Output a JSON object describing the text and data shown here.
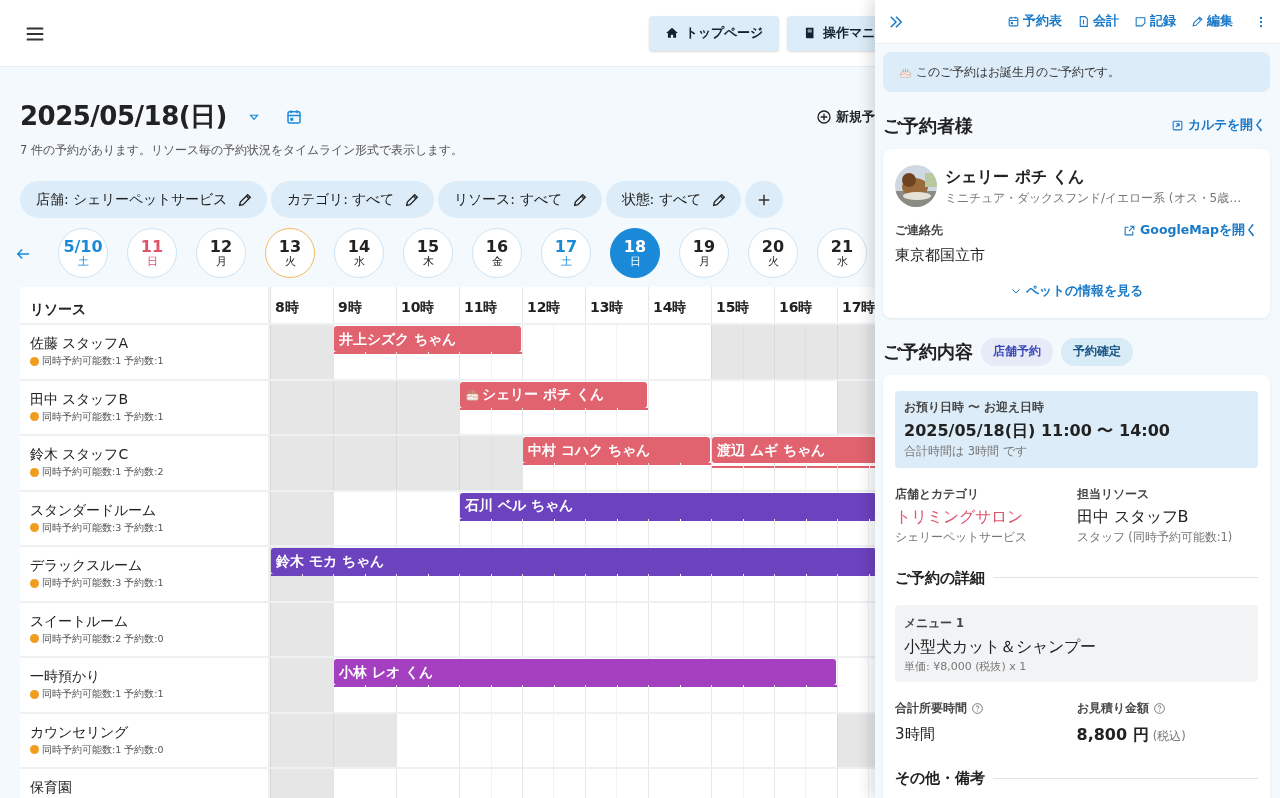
{
  "nav_buttons": [
    {
      "label": "トップページ",
      "kind": "home"
    },
    {
      "label": "操作マニ",
      "kind": "book"
    }
  ],
  "date_title": "2025/05/18(日)",
  "summary": "7 件の予約があります。リソース毎の予約状況をタイムライン形式で表示します。",
  "new_button": "新規予",
  "filters": [
    "店舗: シェリーペットサービス",
    "カテゴリ: すべて",
    "リソース: すべて",
    "状態: すべて"
  ],
  "dates": [
    {
      "day": "5/10",
      "weekday": "土",
      "kind": "saturday",
      "today": false,
      "selected": false
    },
    {
      "day": "11",
      "weekday": "日",
      "kind": "sunday",
      "today": false,
      "selected": false
    },
    {
      "day": "12",
      "weekday": "月",
      "kind": "weekday",
      "today": false,
      "selected": false
    },
    {
      "day": "13",
      "weekday": "火",
      "kind": "weekday",
      "today": true,
      "selected": false
    },
    {
      "day": "14",
      "weekday": "水",
      "kind": "weekday",
      "today": false,
      "selected": false
    },
    {
      "day": "15",
      "weekday": "木",
      "kind": "weekday",
      "today": false,
      "selected": false
    },
    {
      "day": "16",
      "weekday": "金",
      "kind": "weekday",
      "today": false,
      "selected": false
    },
    {
      "day": "17",
      "weekday": "土",
      "kind": "saturday",
      "today": false,
      "selected": false
    },
    {
      "day": "18",
      "weekday": "日",
      "kind": "sunday",
      "today": false,
      "selected": true
    },
    {
      "day": "19",
      "weekday": "月",
      "kind": "weekday",
      "today": false,
      "selected": false
    },
    {
      "day": "20",
      "weekday": "火",
      "kind": "weekday",
      "today": false,
      "selected": false
    },
    {
      "day": "21",
      "weekday": "水",
      "kind": "weekday",
      "today": false,
      "selected": false
    }
  ],
  "timeline": {
    "resource_header": "リソース",
    "hours": [
      "8時",
      "9時",
      "10時",
      "11時",
      "12時",
      "13時",
      "14時",
      "15時",
      "16時",
      "17時"
    ],
    "rows": [
      {
        "name": "佐藤 スタッフA",
        "info": "同時予約可能数:1 予約数:1",
        "closed": [
          true,
          true,
          false,
          false,
          false,
          false,
          false,
          false,
          false,
          false,
          false,
          false,
          false,
          false,
          true,
          true,
          true,
          true,
          true,
          true
        ],
        "bookings": [
          {
            "label": "井上シズク ちゃん",
            "slots": [
              false,
              false,
              true,
              true,
              true,
              true,
              true,
              true,
              false,
              false,
              false,
              false,
              false,
              false,
              false,
              false,
              false,
              false,
              false,
              false
            ],
            "color": "#e0636f",
            "birthday": false
          }
        ]
      },
      {
        "name": "田中 スタッフB",
        "info": "同時予約可能数:1 予約数:1",
        "closed": [
          true,
          true,
          true,
          true,
          true,
          true,
          false,
          false,
          false,
          false,
          false,
          false,
          false,
          false,
          false,
          false,
          false,
          false,
          true,
          true
        ],
        "bookings": [
          {
            "label": "シェリー ポチ くん",
            "slots": [
              false,
              false,
              false,
              false,
              false,
              false,
              true,
              true,
              true,
              true,
              true,
              true,
              false,
              false,
              false,
              false,
              false,
              false,
              false,
              false
            ],
            "color": "#e0636f",
            "birthday": true
          }
        ]
      },
      {
        "name": "鈴木 スタッフC",
        "info": "同時予約可能数:1 予約数:2",
        "closed": [
          true,
          true,
          true,
          true,
          true,
          true,
          true,
          true,
          false,
          false,
          false,
          false,
          false,
          false,
          false,
          false,
          false,
          false,
          false,
          false
        ],
        "bookings": [
          {
            "label": "中村 コハク ちゃん",
            "slots": [
              false,
              false,
              false,
              false,
              false,
              false,
              false,
              false,
              true,
              true,
              true,
              true,
              true,
              true,
              false,
              false,
              false,
              false,
              false,
              false
            ],
            "color": "#e0636f",
            "birthday": false
          },
          {
            "label": "渡辺 ムギ ちゃん",
            "slots": [
              false,
              false,
              false,
              false,
              false,
              false,
              false,
              false,
              false,
              false,
              false,
              false,
              false,
              false,
              true,
              true,
              true,
              true,
              true,
              true
            ],
            "color": "#e0636f",
            "birthday": false
          }
        ]
      },
      {
        "name": "スタンダードルーム",
        "info": "同時予約可能数:3 予約数:1",
        "closed": [
          true,
          true,
          false,
          false,
          false,
          false,
          false,
          false,
          false,
          false,
          false,
          false,
          false,
          false,
          false,
          false,
          false,
          false,
          false,
          false
        ],
        "bookings": [
          {
            "label": "石川 ベル ちゃん",
            "slots": [
              false,
              false,
              false,
              false,
              false,
              false,
              true,
              true,
              true,
              true,
              true,
              true,
              true,
              true,
              true,
              true,
              true,
              true,
              true,
              true
            ],
            "color": "#6c42bf",
            "birthday": false
          }
        ]
      },
      {
        "name": "デラックスルーム",
        "info": "同時予約可能数:3 予約数:1",
        "closed": [
          true,
          true,
          false,
          false,
          false,
          false,
          false,
          false,
          false,
          false,
          false,
          false,
          false,
          false,
          false,
          false,
          false,
          false,
          false,
          false
        ],
        "bookings": [
          {
            "label": "鈴木 モカ ちゃん",
            "slots": [
              true,
              true,
              true,
              true,
              true,
              true,
              true,
              true,
              true,
              true,
              true,
              true,
              true,
              true,
              true,
              true,
              true,
              true,
              true,
              true
            ],
            "color": "#6c42bf",
            "birthday": false
          }
        ]
      },
      {
        "name": "スイートルーム",
        "info": "同時予約可能数:2 予約数:0",
        "closed": [
          true,
          true,
          false,
          false,
          false,
          false,
          false,
          false,
          false,
          false,
          false,
          false,
          false,
          false,
          false,
          false,
          false,
          false,
          false,
          false
        ],
        "bookings": []
      },
      {
        "name": "一時預かり",
        "info": "同時予約可能数:1 予約数:1",
        "closed": [
          true,
          true,
          false,
          false,
          false,
          false,
          false,
          false,
          false,
          false,
          false,
          false,
          false,
          false,
          false,
          false,
          false,
          false,
          false,
          false
        ],
        "bookings": [
          {
            "label": "小林 レオ くん",
            "slots": [
              false,
              false,
              true,
              true,
              true,
              true,
              true,
              true,
              true,
              true,
              true,
              true,
              true,
              true,
              true,
              true,
              true,
              true,
              false,
              false
            ],
            "color": "#a43fbf",
            "birthday": false
          }
        ]
      },
      {
        "name": "カウンセリング",
        "info": "同時予約可能数:1 予約数:0",
        "closed": [
          true,
          true,
          true,
          true,
          false,
          false,
          false,
          false,
          false,
          false,
          false,
          false,
          false,
          false,
          false,
          false,
          false,
          false,
          true,
          true
        ],
        "bookings": []
      },
      {
        "name": "保育園",
        "closed": [
          true,
          true,
          false,
          false,
          false,
          false,
          false,
          false,
          false,
          false,
          false,
          false,
          false,
          false,
          false,
          false,
          false,
          false,
          false,
          false
        ],
        "bookings": []
      }
    ]
  },
  "panel": {
    "toolbar": [
      {
        "label": "予約表",
        "kind": "calendar"
      },
      {
        "label": "会計",
        "kind": "receipt"
      },
      {
        "label": "記録",
        "kind": "note"
      },
      {
        "label": "編集",
        "kind": "pencil"
      }
    ],
    "notice": "このご予約はお誕生月のご予約です。",
    "customer_heading": "ご予約者様",
    "chart_link": "カルテを開く",
    "pet_name": "シェリー ポチ くん",
    "pet_desc": "ミニチュア・ダックスフンド/イエロー系 (オス・5歳…",
    "contact_label": "ご連絡先",
    "map_link": "GoogleMapを開く",
    "address": "東京都国立市",
    "pet_info_link": "ペットの情報を見る",
    "booking_heading": "ご予約内容",
    "badges": [
      {
        "label": "店舗予約",
        "kind": "channel"
      },
      {
        "label": "予約確定",
        "kind": "status"
      }
    ],
    "period_label": "お預り日時 〜 お迎え日時",
    "period": "2025/05/18(日) 11:00 〜 14:00",
    "period_note": "合計時間は 3時間 です",
    "store_label": "店舗とカテゴリ",
    "category": "トリミングサロン",
    "store": "シェリーペットサービス",
    "resource_label": "担当リソース",
    "resource": "田中 スタッフB",
    "resource_note": "スタッフ (同時予約可能数:1)",
    "details_heading": "ご予約の詳細",
    "menu_items": [
      {
        "label": "メニュー 1",
        "name": "小型犬カット＆シャンプー",
        "price": "単価: ¥8,000 (税抜) x 1"
      }
    ],
    "duration_label": "合計所要時間",
    "duration": "3時間",
    "estimate_label": "お見積り金額",
    "estimate": "8,800 円",
    "tax_note": "(税込)",
    "other_heading": "その他・備考"
  }
}
